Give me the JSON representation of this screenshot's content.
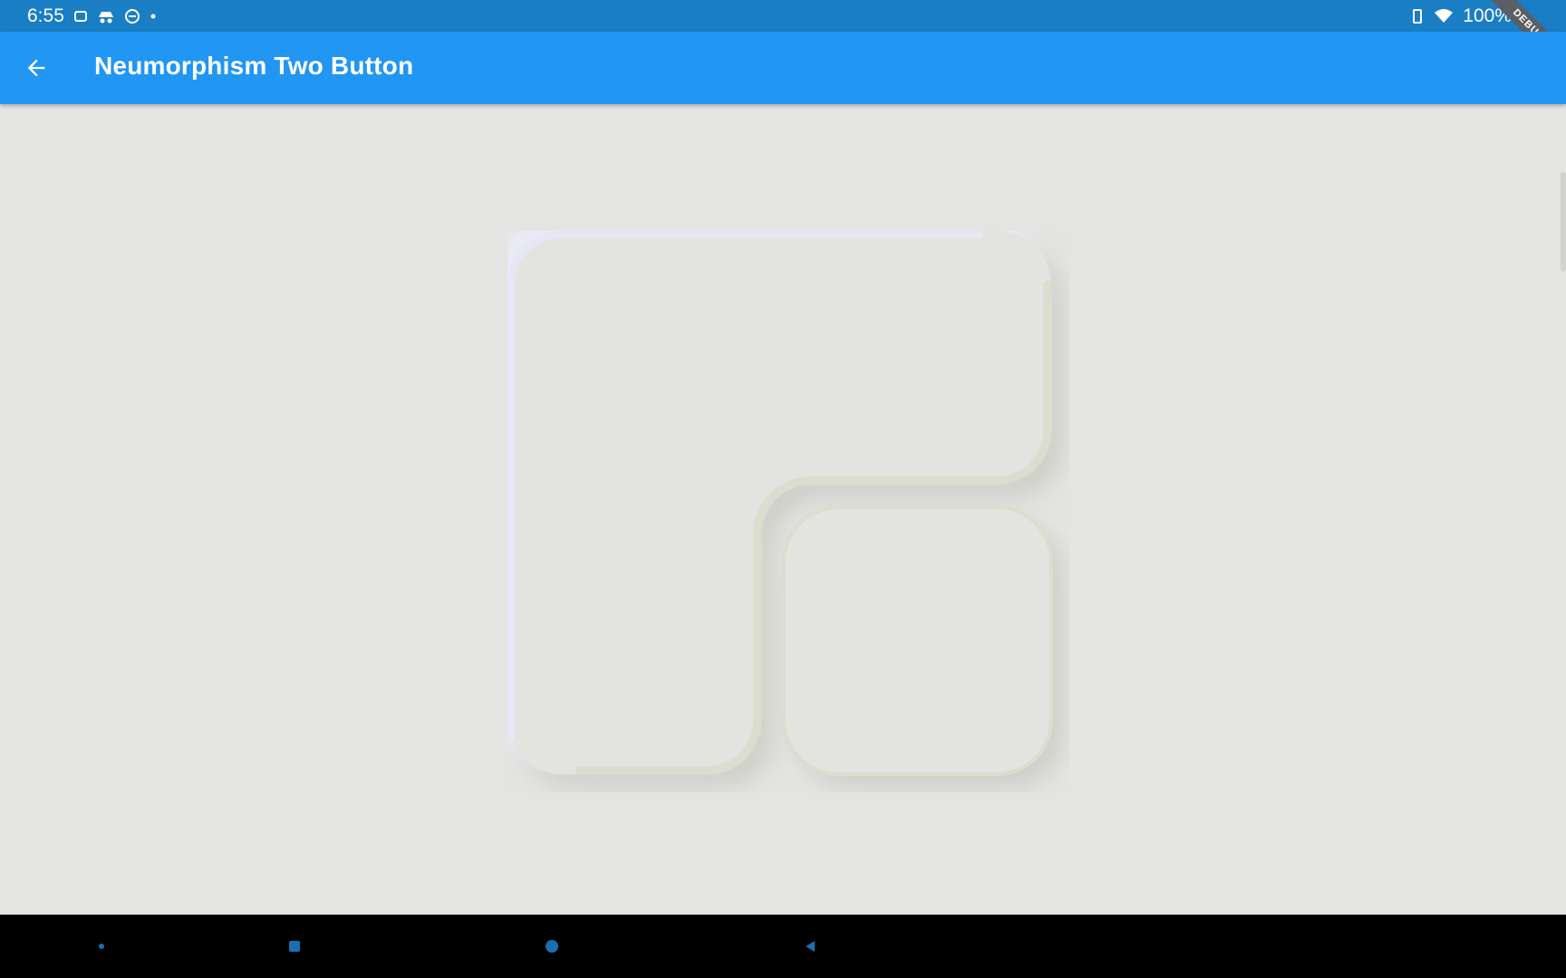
{
  "status_bar": {
    "time": "6:55",
    "battery": "100%"
  },
  "app_bar": {
    "title": "Neumorphism Two Button",
    "debug_label": "DEBUG"
  },
  "colors": {
    "status_bar": "#1a7ec4",
    "app_bar": "#2196f3",
    "background": "#e4e4e2",
    "highlight": "#e8e8f6",
    "shadow": "#d2d2c8",
    "nav_bar": "#000000"
  },
  "icons": {
    "back": "arrow-back-icon",
    "nav": [
      "menu-dot-icon",
      "home-square-icon",
      "home-circle-icon",
      "back-triangle-icon"
    ]
  }
}
